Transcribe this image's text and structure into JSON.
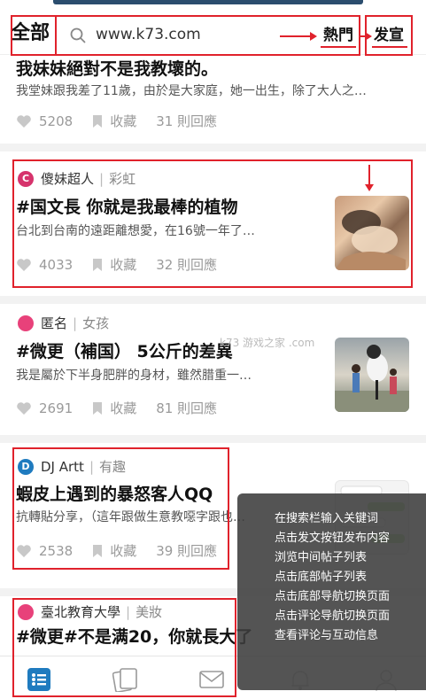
{
  "header": {
    "tab_all": "全部",
    "search_placeholder": "www.k73.com",
    "hot_label": "熱門",
    "post_label": "发宣"
  },
  "posts": [
    {
      "title": "我妹妹絕對不是我教壞的。",
      "excerpt": "我堂妹跟我差了11歲，由於是大家庭，她一出生，除了大人之…",
      "likes": "5208",
      "save_label": "收藏",
      "replies": "31 則回應"
    },
    {
      "avatar_letter": "C",
      "avatar_color": "#d6336c",
      "author": "傻妹超人",
      "board": "彩虹",
      "title": "#国文長 你就是我最棒的植物",
      "excerpt": "台北到台南的遠距離想愛，在16號一年了…",
      "likes": "4033",
      "save_label": "收藏",
      "replies": "32 則回應"
    },
    {
      "avatar_letter": "",
      "avatar_color": "#e8417a",
      "author": "匿名",
      "board": "女孩",
      "title": "#微更（補国） 5公斤的差異",
      "excerpt": "我是屬於下半身肥胖的身材，雖然腊重一…",
      "likes": "2691",
      "save_label": "收藏",
      "replies": "81 則回應"
    },
    {
      "avatar_letter": "D",
      "avatar_color": "#1f7bbf",
      "author": "DJ Artt",
      "board": "有趣",
      "title": "蝦皮上遇到的暴怒客人QQ",
      "excerpt": "抗轉貼分享，（這年跟做生意教噁字跟也…",
      "likes": "2538",
      "save_label": "收藏",
      "replies": "39 則回應"
    },
    {
      "avatar_letter": "",
      "avatar_color": "#e8417a",
      "author": "臺北教育大學",
      "board": "美妝",
      "title": "#微更#不是满20，你就長大了"
    }
  ],
  "tooltip": [
    "在搜索栏输入关键词",
    "点击发文按钮发布内容",
    "浏览中间帖子列表",
    "点击底部帖子列表",
    "点击底部导航切换页面",
    "点击评论导航切换页面",
    "查看评论与互动信息"
  ],
  "watermark": "k73 游戏之家 .com",
  "colors": {
    "annotation_red": "#e0222c",
    "nav_active": "#1f7bbf",
    "stat_gray": "#9a9a9a"
  },
  "icons": [
    "search-icon",
    "heart-icon",
    "bookmark-icon",
    "list-icon",
    "cards-icon",
    "mail-icon",
    "bell-icon",
    "person-icon"
  ]
}
